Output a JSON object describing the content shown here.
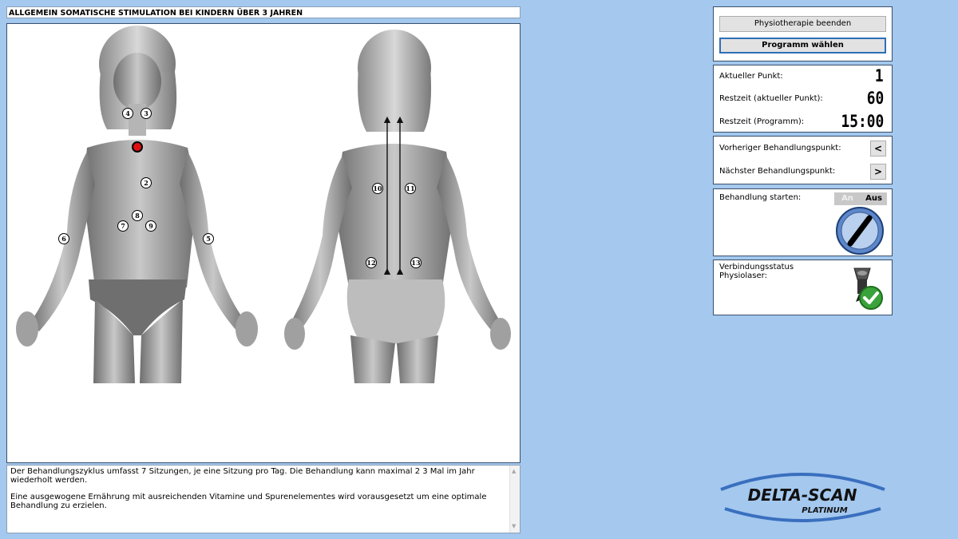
{
  "program_title": "ALLGEMEIN SOMATISCHE STIMULATION BEI KINDERN ÜBER 3 JAHREN",
  "treatment_points": {
    "front": [
      "4",
      "3",
      "2",
      "8",
      "7",
      "9",
      "6",
      "5"
    ],
    "back": [
      "10",
      "11",
      "12",
      "13"
    ],
    "active_point": "1"
  },
  "description": {
    "paragraph1": "Der Behandlungszyklus umfasst 7 Sitzungen, je eine Sitzung pro Tag. Die Behandlung kann maximal 2  3 Mal im Jahr wiederholt werden.",
    "paragraph2": "Eine ausgewogene Ernährung mit ausreichenden Vitamine und Spurenelementes wird vorausgesetzt um eine optimale Behandlung zu erzielen."
  },
  "controls": {
    "end_button": "Physiotherapie beenden",
    "choose_button": "Programm wählen"
  },
  "status": {
    "current_point_label": "Aktueller Punkt:",
    "current_point_value": "1",
    "remaining_point_label": "Restzeit (aktueller Punkt):",
    "remaining_point_value": "60",
    "remaining_program_label": "Restzeit (Programm):",
    "remaining_program_value": "15:00"
  },
  "navigation": {
    "prev_label": "Vorheriger Behandlungspunkt:",
    "prev_button": "<",
    "next_label": "Nächster Behandlungspunkt:",
    "next_button": ">"
  },
  "treatment": {
    "start_label": "Behandlung starten:",
    "toggle_on": "An",
    "toggle_off": "Aus",
    "state": "Aus"
  },
  "connection": {
    "label": "Verbindungsstatus\nPhysiolaser:",
    "connected": true,
    "icons": [
      "laser-device-icon",
      "check-icon"
    ]
  },
  "brand": {
    "name": "DELTA-SCAN",
    "sub": "PLATINUM",
    "colors": {
      "accent": "#2f6fb6",
      "logo_dark": "#111111",
      "logo_blue": "#3a6fbf"
    }
  }
}
